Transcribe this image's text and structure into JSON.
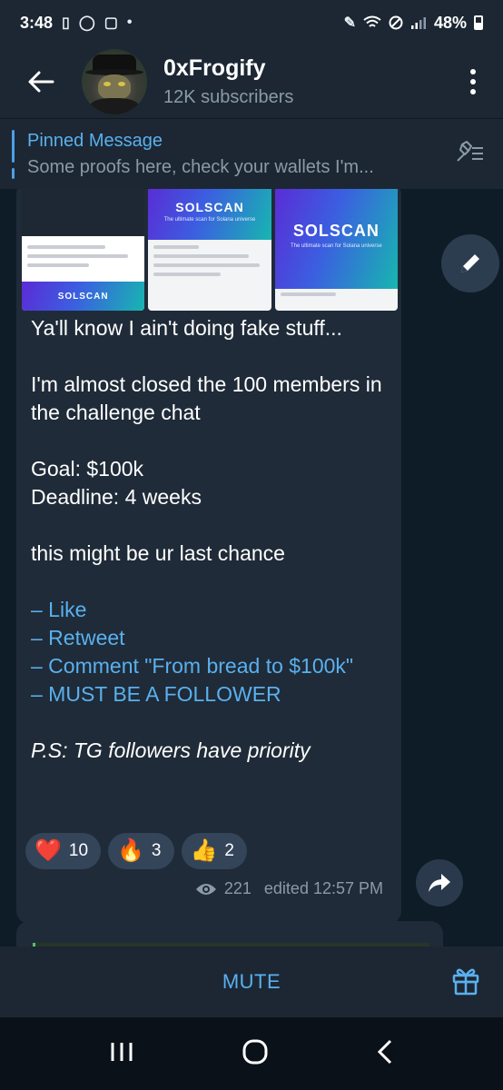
{
  "status_bar": {
    "time": "3:48",
    "dot": "•",
    "battery": "48%"
  },
  "header": {
    "title": "0xFrogify",
    "subtitle": "12K subscribers"
  },
  "pinned": {
    "title": "Pinned Message",
    "text": "Some proofs here, check your wallets  I'm..."
  },
  "thumbnails": {
    "brand": "SOLSCAN",
    "tagline": "The ultimate scan for Solana universe"
  },
  "message": {
    "paragraphs": [
      "Ya'll know I ain't doing fake stuff...",
      "I'm almost closed the 100 members in the challenge chat",
      "Goal: $100k",
      "Deadline: 4 weeks",
      "this might be ur last chance"
    ],
    "links": [
      "– Like",
      "– Retweet",
      "– Comment \"From bread to $100k\"",
      "– MUST BE A FOLLOWER"
    ],
    "footnote": "P.S: TG followers have priority"
  },
  "reactions": [
    {
      "emoji": "❤️",
      "count": "10"
    },
    {
      "emoji": "🔥",
      "count": "3"
    },
    {
      "emoji": "👍",
      "count": "2"
    }
  ],
  "meta": {
    "views": "221",
    "edited": "edited 12:57 PM"
  },
  "bottom": {
    "mute_label": "MUTE"
  },
  "icons": {
    "back": "back-arrow-icon",
    "menu": "more-vertical-icon",
    "unpin": "pin-list-icon",
    "edit": "pencil-icon",
    "forward": "share-forward-icon",
    "gift": "gift-icon",
    "views": "eye-icon"
  },
  "colors": {
    "accent": "#5ab0ee",
    "bubble": "#1f2b38",
    "header": "#1c2733",
    "muted": "#8b9aa8"
  }
}
